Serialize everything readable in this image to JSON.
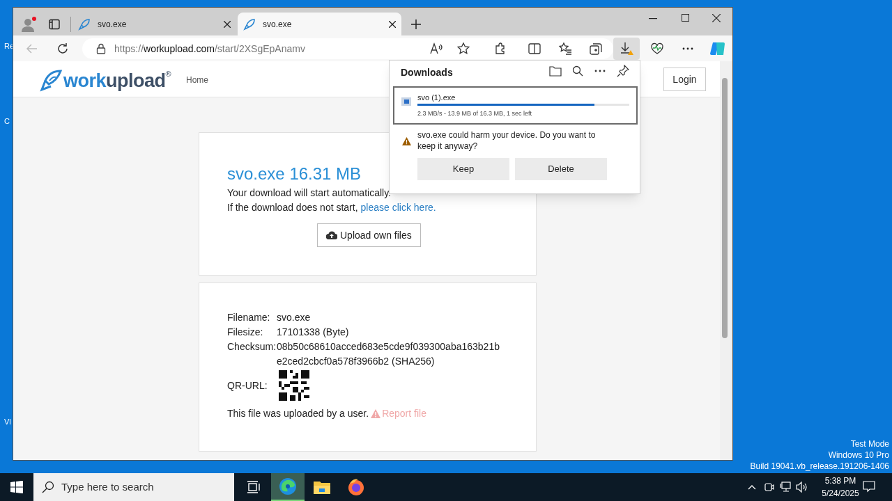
{
  "desktop": {
    "icon_labels": [
      "Re",
      "C",
      "Vl"
    ],
    "system_lines": [
      "Test Mode",
      "Windows 10 Pro",
      "Build 19041.vb_release.191206-1406"
    ]
  },
  "browser": {
    "tabs": [
      {
        "title": "svo.exe",
        "selected": false
      },
      {
        "title": "svo.exe",
        "selected": true
      }
    ],
    "address": {
      "scheme": "https://",
      "domain": "workupload.com",
      "path": "/start/2XSgEpAnamv"
    }
  },
  "page": {
    "logo": {
      "part_a": "work",
      "part_b": "upload",
      "mark": "®"
    },
    "nav": [
      "Home"
    ],
    "login": "Login",
    "download_card": {
      "title": "svo.exe 16.31 MB",
      "line1": "Your download will start automatically.",
      "line2": "If the download does not start,",
      "link": "please click here.",
      "upload_button": "Upload own files"
    },
    "info": [
      {
        "label": "Filename:",
        "lines": [
          "svo.exe"
        ]
      },
      {
        "label": "Filesize:",
        "lines": [
          "17101338 (Byte)"
        ]
      },
      {
        "label": "Checksum:",
        "lines": [
          "08b50c68610acced683e5cde9f039300aba163b21b",
          "e2ced2cbcf0a578f3966b2 (SHA256)"
        ]
      }
    ],
    "qr_label": "QR-URL:",
    "uploaded_text": "This file was uploaded by a user.",
    "report_link": "Report file"
  },
  "downloads_panel": {
    "title": "Downloads",
    "item": {
      "name": "svo (1).exe",
      "level": 0.835,
      "status": "2.3 MB/s - 13.9 MB of 16.3 MB, 1 sec left"
    },
    "warning": "svo.exe could harm your device. Do you want to keep it anyway?",
    "buttons": [
      "Keep",
      "Delete"
    ]
  },
  "taskbar": {
    "search_placeholder": "Type here to search",
    "time": "5:38 PM",
    "date": "5/24/2025",
    "apps": [
      {
        "kind": "taskview",
        "active": false
      },
      {
        "kind": "edge",
        "active": true
      },
      {
        "kind": "folder",
        "active": false
      },
      {
        "kind": "firefox",
        "active": false
      }
    ]
  }
}
